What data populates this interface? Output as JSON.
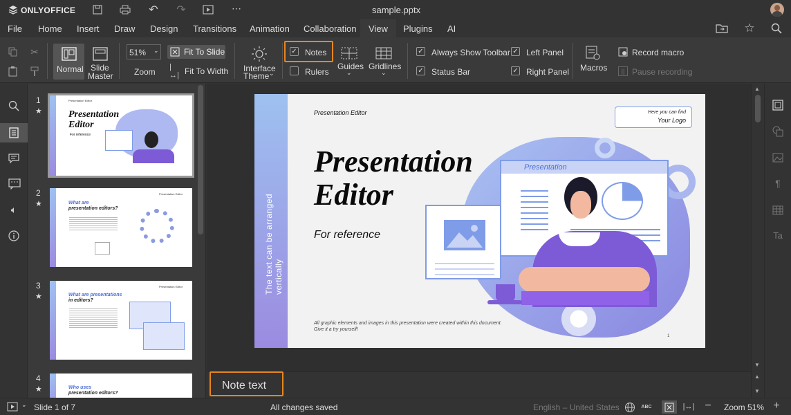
{
  "app": {
    "logo_text": "ONLYOFFICE",
    "file_name": "sample.pptx"
  },
  "menu": {
    "items": [
      "File",
      "Home",
      "Insert",
      "Draw",
      "Design",
      "Transitions",
      "Animation",
      "Collaboration",
      "View",
      "Plugins",
      "AI"
    ],
    "active": "View"
  },
  "ribbon": {
    "normal": "Normal",
    "slide_master_1": "Slide",
    "slide_master_2": "Master",
    "zoom_value": "51%",
    "zoom_label": "Zoom",
    "fit_to_slide": "Fit To Slide",
    "fit_to_width": "Fit To Width",
    "interface_theme_1": "Interface",
    "interface_theme_2": "Theme",
    "notes": "Notes",
    "rulers": "Rulers",
    "guides": "Guides",
    "gridlines": "Gridlines",
    "always_show_toolbar": "Always Show Toolbar",
    "status_bar": "Status Bar",
    "left_panel": "Left Panel",
    "right_panel": "Right Panel",
    "macros": "Macros",
    "record_macro": "Record macro",
    "pause_recording": "Pause recording"
  },
  "checks": {
    "notes": true,
    "rulers": false,
    "always_show_toolbar": true,
    "status_bar": true,
    "left_panel": true,
    "right_panel": true
  },
  "thumbnails": [
    {
      "num": "1",
      "title": "Presentation Editor",
      "sub": "For reference",
      "small": "Presentation Editor"
    },
    {
      "num": "2",
      "title_1": "What are",
      "title_2": "presentation editors?",
      "small": "Presentation Editor"
    },
    {
      "num": "3",
      "title_1": "What are presentations",
      "title_2": "in editors?",
      "small": "Presentation Editor"
    },
    {
      "num": "4",
      "title_1": "Who uses",
      "title_2": "presentation editors?"
    }
  ],
  "slide": {
    "header": "Presentation Editor",
    "logo_line1": "Here you can find",
    "logo_line2": "Your Logo",
    "title_1": "Presentation",
    "title_2": "Editor",
    "subtitle": "For reference",
    "vertical": "The text can be arranged vertically",
    "window_title": "Presentation",
    "footer_1": "All graphic elements and images in this presentation were created within this document.",
    "footer_2": "Give it a try yourself!",
    "page": "1"
  },
  "notes": {
    "text": "Note text"
  },
  "status": {
    "slide": "Slide 1 of 7",
    "saved": "All changes saved",
    "language": "English – United States",
    "zoom": "Zoom 51%"
  },
  "colors": {
    "accent": "#e8861e",
    "bg_dark": "#333333",
    "slide_blue": "#7f9ce8",
    "slide_purple": "#7d5bd6"
  }
}
